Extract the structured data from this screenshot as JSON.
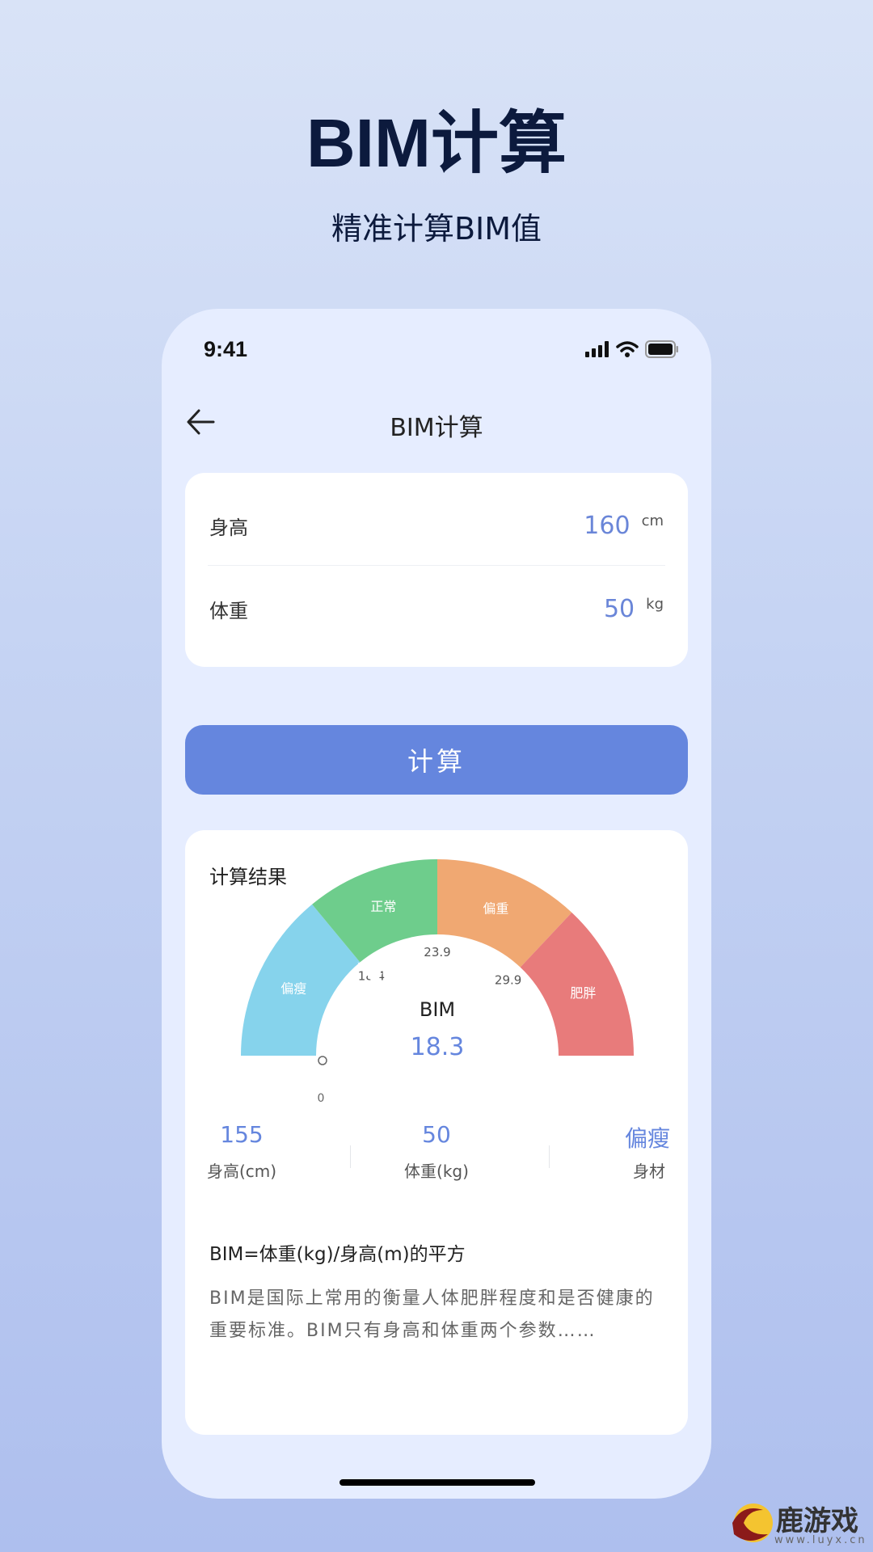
{
  "hero": {
    "title": "BIM计算",
    "subtitle": "精准计算BIM值"
  },
  "status_bar": {
    "time": "9:41",
    "icons": [
      "signal-icon",
      "wifi-icon",
      "battery-icon"
    ]
  },
  "nav": {
    "back_icon": "arrow-left-icon",
    "title": "BIM计算"
  },
  "inputs": [
    {
      "label": "身高",
      "value": "160",
      "unit": "cm"
    },
    {
      "label": "体重",
      "value": "50",
      "unit": "kg"
    }
  ],
  "calculate_button": {
    "label": "计算"
  },
  "result": {
    "title": "计算结果",
    "gauge": {
      "center_label": "BIM",
      "value": "18.3",
      "min_label": "0",
      "segments": [
        {
          "label": "偏瘦",
          "color": "#86d3ec",
          "share": 0.28
        },
        {
          "label": "正常",
          "color": "#6ecd8c",
          "share": 0.22
        },
        {
          "label": "偏重",
          "color": "#f0a872",
          "share": 0.24
        },
        {
          "label": "肥胖",
          "color": "#e87b7b",
          "share": 0.26
        }
      ],
      "thresholds": [
        "18.4",
        "23.9",
        "29.9"
      ],
      "pointer_position": 0.275
    },
    "stats": [
      {
        "value": "155",
        "label": "身高(cm)"
      },
      {
        "value": "50",
        "label": "体重(kg)"
      },
      {
        "value": "偏瘦",
        "label": "身材"
      }
    ],
    "formula": "BIM=体重(kg)/身高(m)的平方",
    "description": "BIM是国际上常用的衡量人体肥胖程度和是否健康的重要标准。BIM只有身高和体重两个参数……"
  },
  "watermark": {
    "name": "鹿游戏",
    "url": "www.luyx.cn"
  },
  "colors": {
    "accent": "#6586de",
    "value_text": "#6a86d8",
    "background": "#e6edff"
  }
}
